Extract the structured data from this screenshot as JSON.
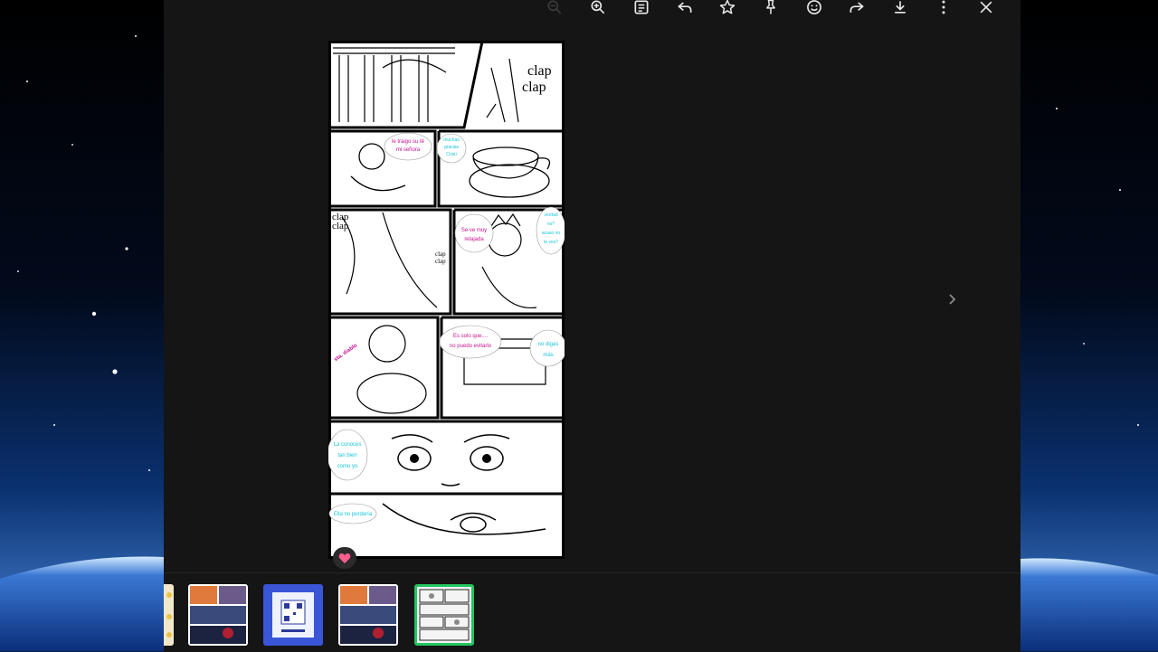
{
  "colors": {
    "viewer_bg": "#151515",
    "selected_thumb_border": "#23c55e",
    "speech_magenta": "#c8128e",
    "speech_cyan": "#18c4d6"
  },
  "toolbar": {
    "buttons": [
      {
        "icon": "zoom-out-icon"
      },
      {
        "icon": "zoom-in-icon"
      },
      {
        "icon": "caption-icon"
      },
      {
        "icon": "reply-icon"
      },
      {
        "icon": "star-icon"
      },
      {
        "icon": "pin-icon"
      },
      {
        "icon": "emoji-icon"
      },
      {
        "icon": "forward-icon"
      },
      {
        "icon": "download-icon"
      },
      {
        "icon": "more-icon"
      },
      {
        "icon": "close-icon"
      }
    ]
  },
  "comic": {
    "sfx": {
      "clap_top_1": "clap",
      "clap_top_2": "clap",
      "clap_mid_1": "clap",
      "clap_mid_2": "clap",
      "clap_small_1": "clap",
      "clap_small_2": "clap"
    },
    "bubbles": {
      "b1_l1": "le traigo su té",
      "b1_l2": "mi señora",
      "b2_l1": "muchas",
      "b2_l2": "gracias",
      "b2_l3": "Cristi",
      "b3_l1": "Se ve muy",
      "b3_l2": "relajada",
      "b4_l1": "verdad",
      "b4_l2": "no?",
      "b4_l3": "acaso no",
      "b4_l4": "te ves?",
      "b5": "sta. diablo",
      "b6_l1": "Es solo que....",
      "b6_l2": "no puedo evitarlo",
      "b7_l1": "no digas",
      "b7_l2": "más",
      "b8_l1": "La conoces",
      "b8_l2": "tan bien",
      "b8_l3": "como yo",
      "b9": "Ella no perdería"
    }
  },
  "reaction": {
    "icon": "heart-icon"
  },
  "next": {
    "icon": "chevron-right-icon"
  },
  "thumbnails": [
    {
      "name": "thumb-partial",
      "selected": false
    },
    {
      "name": "thumb-comic-color-1",
      "selected": false
    },
    {
      "name": "thumb-qr-page",
      "selected": false
    },
    {
      "name": "thumb-comic-color-2",
      "selected": false
    },
    {
      "name": "thumb-comic-bw",
      "selected": true
    }
  ]
}
